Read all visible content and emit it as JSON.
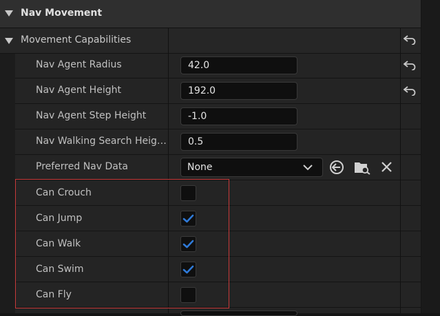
{
  "section": {
    "title": "Nav Movement"
  },
  "group": {
    "label": "Movement Capabilities"
  },
  "properties": {
    "nav_agent_radius": {
      "label": "Nav Agent Radius",
      "value": "42.0"
    },
    "nav_agent_height": {
      "label": "Nav Agent Height",
      "value": "192.0"
    },
    "nav_agent_step_height": {
      "label": "Nav Agent Step Height",
      "value": "-1.0"
    },
    "nav_walking_search_height": {
      "label": "Nav Walking Search Heigh…",
      "value": "0.5"
    },
    "preferred_nav_data": {
      "label": "Preferred Nav Data",
      "value": "None"
    },
    "can_crouch": {
      "label": "Can Crouch",
      "checked": false
    },
    "can_jump": {
      "label": "Can Jump",
      "checked": true
    },
    "can_walk": {
      "label": "Can Walk",
      "checked": true
    },
    "can_swim": {
      "label": "Can Swim",
      "checked": true
    },
    "can_fly": {
      "label": "Can Fly",
      "checked": false
    }
  },
  "colors": {
    "accent_blue": "#2f7ad8",
    "highlight_red": "#c83a3a",
    "row_bg": "#242424",
    "header_bg": "#2f2f2f",
    "field_bg": "#0f0f0f"
  },
  "icons": {
    "reset": "reset-to-default-icon",
    "use_selected": "use-selected-asset-icon",
    "browse": "browse-to-asset-icon",
    "clear": "clear-icon",
    "expand": "triangle-down-icon",
    "dropdown": "chevron-down-icon",
    "check": "checkmark-icon"
  }
}
